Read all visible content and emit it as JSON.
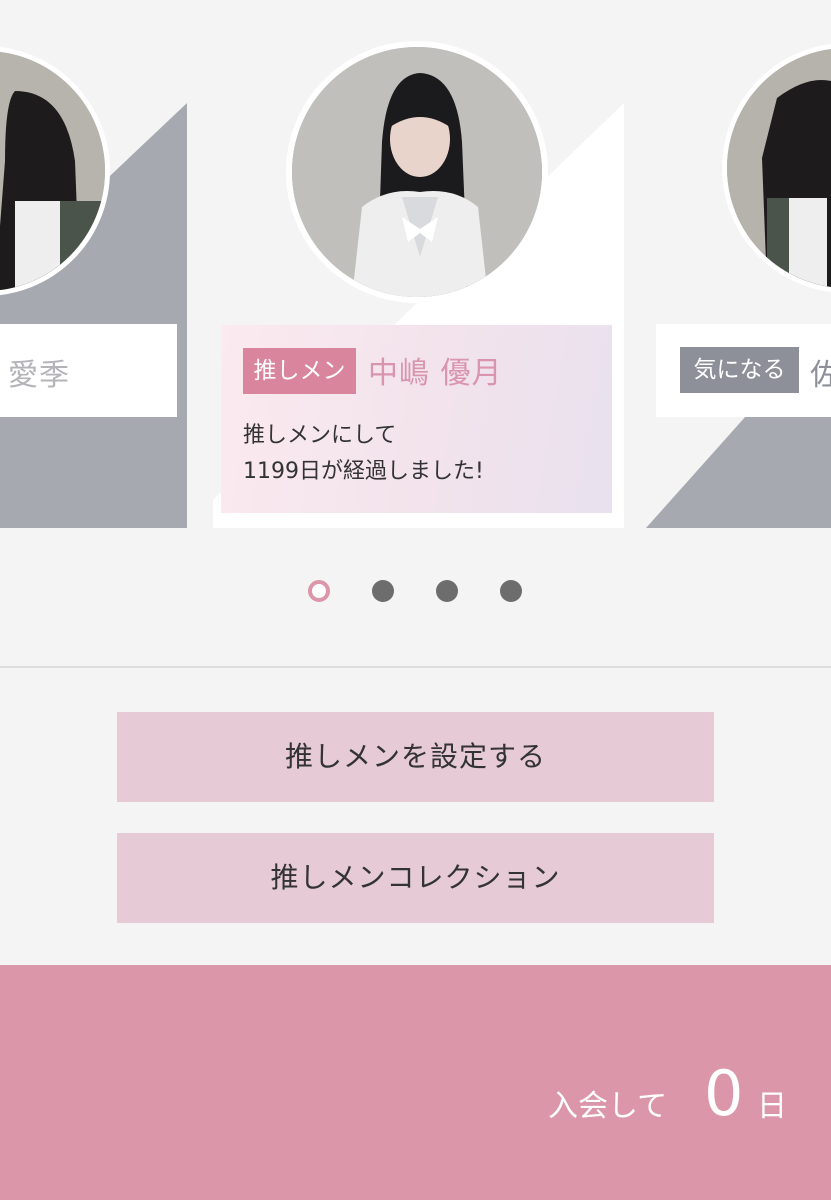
{
  "carousel": {
    "left_card": {
      "tag": "",
      "name_partial": "愛季"
    },
    "center_card": {
      "tag": "推しメン",
      "name": "中嶋 優月",
      "message_line1": "推しメンにして",
      "message_line2": "1199日が経過しました!"
    },
    "right_card": {
      "tag": "気になる",
      "name_partial": "佐"
    },
    "page_indicator": {
      "total": 4,
      "active_index": 0
    }
  },
  "actions": {
    "set_oshimen_label": "推しメンを設定する",
    "collection_label": "推しメンコレクション"
  },
  "footer": {
    "joined_label": "入会して",
    "days_value": "0",
    "days_unit": "日"
  },
  "colors": {
    "accent_pink": "#dc96aa",
    "tag_pink": "#d9859d",
    "tag_gray": "#8d9099",
    "name_pink": "#d995ad",
    "button_bg": "#e6cad5",
    "card_gray": "#a6a9b0"
  }
}
